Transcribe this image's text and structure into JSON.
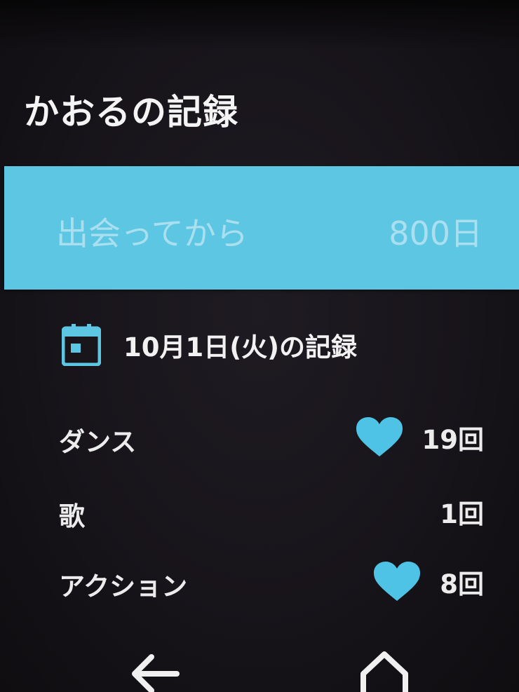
{
  "header": {
    "title": "かおるの記録"
  },
  "banner": {
    "label": "出会ってから",
    "value": "800日"
  },
  "date_section": {
    "icon": "calendar-icon",
    "label": "10月1日(火)の記録"
  },
  "records": [
    {
      "name": "ダンス",
      "count": "19回",
      "heart": true
    },
    {
      "name": "歌",
      "count": "1回",
      "heart": false
    },
    {
      "name": "アクション",
      "count": "8回",
      "heart": true
    }
  ],
  "nav": {
    "back_icon": "back-arrow-icon",
    "home_icon": "home-icon"
  },
  "colors": {
    "accent": "#5dc6e3",
    "background": "#17141a",
    "text": "#f2f2f2"
  }
}
